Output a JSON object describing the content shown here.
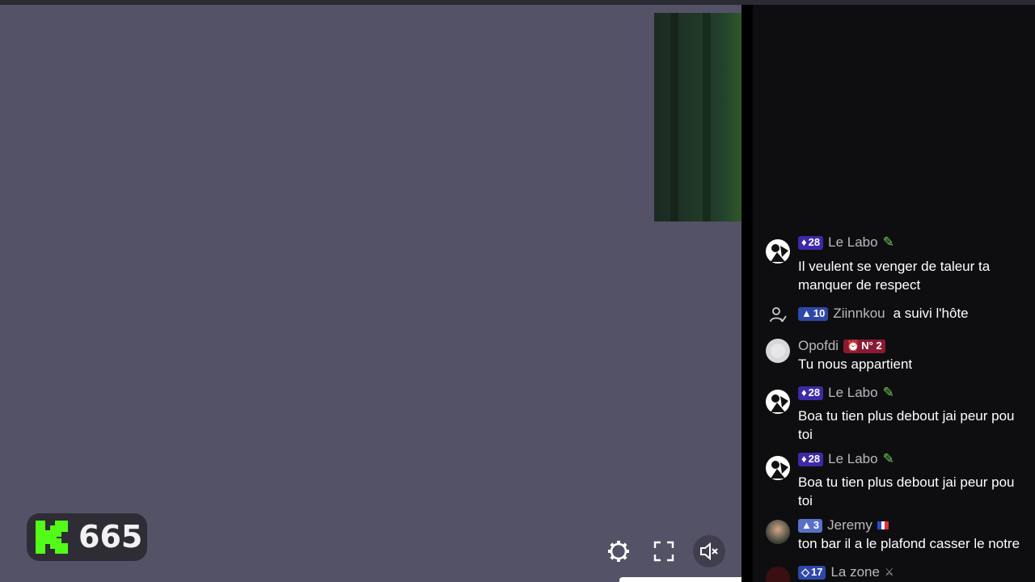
{
  "colors": {
    "player_bg": "#545266",
    "chat_bg": "#0e0e10",
    "kick_green": "#53fc18",
    "sub_badge": "#3d2aa8",
    "level_badge": "#2f48a8",
    "top_badge": "#8a1a33"
  },
  "counter": {
    "icon": "kick-logo-icon",
    "value": "665"
  },
  "controls": {
    "settings_icon": "gear-icon",
    "fullscreen_icon": "fullscreen-icon",
    "mute_icon": "speaker-muted-icon"
  },
  "chat": {
    "messages": [
      {
        "type": "message",
        "badge": "28",
        "badge_icon": "gem-icon",
        "username": "Le Labo",
        "suffix_icon": "pencil-icon",
        "lines": [
          "Il veulent se venger de taleur ta",
          "manquer de respect"
        ]
      },
      {
        "type": "follow",
        "badge": "10",
        "badge_icon": "triangle-icon",
        "username": "Ziinnkou",
        "text": "a suivi l'hôte"
      },
      {
        "type": "message",
        "username": "Opofdi",
        "badge": "N° 2",
        "badge_icon": "clock-icon",
        "lines": [
          "Tu nous appartient"
        ]
      },
      {
        "type": "message",
        "badge": "28",
        "badge_icon": "gem-icon",
        "username": "Le Labo",
        "suffix_icon": "pencil-icon",
        "lines": [
          "Boa tu tien plus debout jai peur pou",
          "toi"
        ]
      },
      {
        "type": "message",
        "badge": "28",
        "badge_icon": "gem-icon",
        "username": "Le Labo",
        "suffix_icon": "pencil-icon",
        "lines": [
          "Boa tu tien plus debout jai peur pou",
          "toi"
        ]
      },
      {
        "type": "message",
        "badge": "3",
        "badge_icon": "triangle-icon",
        "username": "Jeremy",
        "suffix_icon": "flag-fr-icon",
        "lines": [
          "ton bar il a le plafond casser le notre"
        ]
      },
      {
        "type": "message",
        "badge": "17",
        "badge_icon": "diamond-icon",
        "username": "La zone",
        "suffix_icon": "swords-icon",
        "lines": []
      }
    ]
  }
}
